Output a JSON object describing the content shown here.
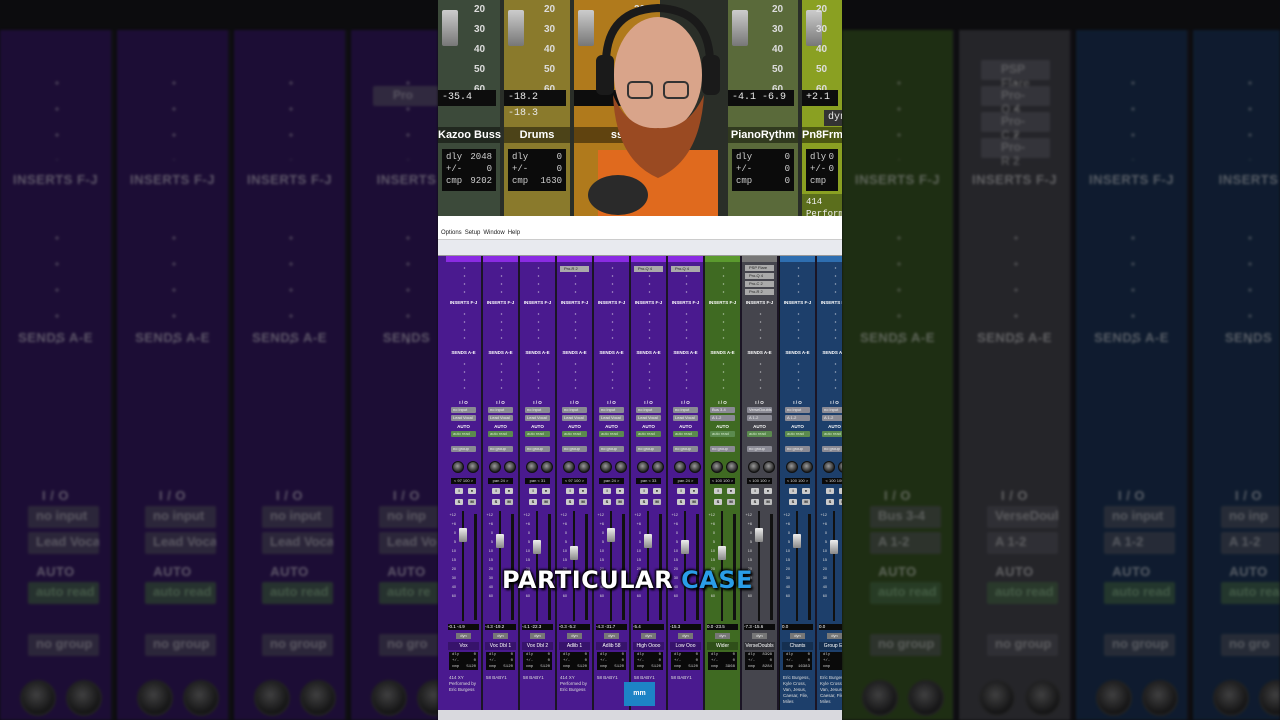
{
  "background": {
    "left_strips": [
      {
        "inserts": "INSERTS F-J",
        "sends": "SENDS A-E",
        "io": "I / O",
        "input": "no input",
        "output": "Lead Vocal",
        "auto": "AUTO",
        "auto_mode": "auto read",
        "group": "no group"
      },
      {
        "inserts": "INSERTS F-J",
        "sends": "SENDS A-E",
        "io": "I / O",
        "input": "no input",
        "output": "Lead Vocal",
        "auto": "AUTO",
        "auto_mode": "auto read",
        "group": "no group"
      },
      {
        "inserts": "INSERTS F-J",
        "sends": "SENDS A-E",
        "io": "I / O",
        "input": "no input",
        "output": "Lead Vocal",
        "auto": "AUTO",
        "auto_mode": "auto read",
        "group": "no group"
      },
      {
        "inserts": "INSERTS",
        "sends": "SENDS",
        "io": "I / O",
        "input": "no inp",
        "output": "Lead Vo",
        "auto": "AUTO",
        "auto_mode": "auto re",
        "group": "no gro",
        "insert_slot": "Pro"
      }
    ],
    "right_strips": [
      {
        "inserts": "INSERTS F-J",
        "sends": "SENDS A-E",
        "io": "I / O",
        "input": "Bus 3-4",
        "output": "A 1-2",
        "auto": "AUTO",
        "auto_mode": "auto read",
        "group": "no group"
      },
      {
        "inserts": "INSERTS F-J",
        "sends": "SENDS A-E",
        "io": "I / O",
        "input": "VerseDoubls",
        "output": "A 1-2",
        "auto": "AUTO",
        "auto_mode": "auto read",
        "group": "no group",
        "plugins": [
          "PSP Flare",
          "Pro-Q 4",
          "Pro-C 2",
          "Pro-R 2"
        ]
      },
      {
        "inserts": "INSERTS F-J",
        "sends": "SENDS A-E",
        "io": "I / O",
        "input": "no input",
        "output": "A 1-2",
        "auto": "AUTO",
        "auto_mode": "auto read",
        "group": "no group"
      },
      {
        "inserts": "INSERTS",
        "sends": "SENDS",
        "io": "I / O",
        "input": "no inp",
        "output": "A 1-2",
        "auto": "AUTO",
        "auto_mode": "auto rea",
        "group": "no gro"
      }
    ]
  },
  "webcam": {
    "strips": [
      {
        "name": "Kazoo Buss",
        "meter": "-35.4",
        "dly": "2048",
        "pm": "0",
        "cmp": "9202",
        "color": "#3c4a3a"
      },
      {
        "name": "Drums",
        "meter": "-18.2  -18.3",
        "dly": "0",
        "pm": "0",
        "cmp": "1630",
        "color": "#8a7a2c"
      },
      {
        "name": "ss",
        "meter": "",
        "dly": "",
        "pm": "",
        "cmp": "",
        "color": "#b07a1c"
      },
      {
        "name": "PianoRythm",
        "meter": "-4.1  -6.9",
        "dly": "0",
        "pm": "0",
        "cmp": "0",
        "color": "#5a6a3a"
      },
      {
        "name": "Pn8Frm",
        "meter": "+2.1",
        "dly": "0",
        "pm": "0",
        "cmp": "",
        "color": "#8aa022"
      }
    ],
    "scale": [
      "20",
      "30",
      "40",
      "50",
      "60"
    ],
    "labels": {
      "dly": "dly",
      "pm": "+/-",
      "cmp": "cmp"
    },
    "perf_label": "414",
    "perf_text": "Perform",
    "dyn_label": "dyn"
  },
  "menu": [
    "Options",
    "Setup",
    "Window",
    "Help"
  ],
  "mixer": {
    "inserts_label": "INSERTS F-J",
    "sends_label": "SENDS A-E",
    "io_label": "I / O",
    "auto_label": "AUTO",
    "auto_mode": "auto read",
    "group_label": "no group",
    "dyn_label": "dyn",
    "scale": [
      "+12",
      "+6",
      "0",
      "5",
      "10",
      "15",
      "20",
      "30",
      "40",
      "60"
    ],
    "info_labels": [
      "dly",
      "+/-",
      "cmp"
    ],
    "tracks": [
      {
        "name": "Vox",
        "input": "no input",
        "output": "Lead Vocal",
        "pan": "< 97  100 >",
        "vals": "-0.1  -4.9",
        "dly": "0",
        "pm": "0",
        "cmp": "5120",
        "comment": "414 XY Performed by Eric Burgess",
        "color": "purple"
      },
      {
        "name": "Voc Dbl 1",
        "input": "no input",
        "output": "Lead Vocal",
        "pan": "pan  24 >",
        "vals": "-4.3  -19.2",
        "dly": "0",
        "pm": "0",
        "cmp": "5120",
        "comment": "58 BABY1",
        "color": "purple"
      },
      {
        "name": "Vox Dbl 2",
        "input": "no input",
        "output": "Lead Vocal",
        "pan": "pan  < 31",
        "vals": "-4.1  -22.3",
        "dly": "0",
        "pm": "0",
        "cmp": "5120",
        "comment": "58 BABY1",
        "color": "purple"
      },
      {
        "name": "Adlib 1",
        "input": "no input",
        "output": "Lead Vocal",
        "pan": "< 97  100 >",
        "vals": "-0.3  -5.2",
        "dly": "0",
        "pm": "0",
        "cmp": "5120",
        "comment": "414 XY Performed by Eric Burgess",
        "color": "purple",
        "plugin": "Pro-R 2"
      },
      {
        "name": "Adlib 58",
        "input": "no input",
        "output": "Lead Vocal",
        "pan": "pan  24 >",
        "vals": "-4.3  -31.7",
        "dly": "0",
        "pm": "0",
        "cmp": "5120",
        "comment": "58 BABY1",
        "color": "purple"
      },
      {
        "name": "High Oooo",
        "input": "no input",
        "output": "Lead Vocal",
        "pan": "pan  < 33",
        "vals": "-5.4",
        "dly": "0",
        "pm": "0",
        "cmp": "5120",
        "comment": "58 BABY1",
        "color": "purple",
        "plugin": "Pro-Q 4"
      },
      {
        "name": "Low Ooo",
        "input": "no input",
        "output": "Lead Vocal",
        "pan": "pan  24 >",
        "vals": "-15.3",
        "dly": "0",
        "pm": "0",
        "cmp": "5120",
        "comment": "58 BABY1",
        "color": "purple",
        "plugin": "Pro-Q 4"
      },
      {
        "name": "Wider",
        "input": "Bus 3-4",
        "output": "A 1-2",
        "pan": "< 100  100 >",
        "vals": "0.0  -23.5",
        "dly": "0",
        "pm": "0",
        "cmp": "3968",
        "comment": "",
        "color": "green"
      },
      {
        "name": "VerseDoubls",
        "input": "VerseDoubls",
        "output": "A 1-2",
        "pan": "< 100  100 >",
        "vals": "-7.3  -15.6",
        "dly": "8398",
        "pm": "0",
        "cmp": "8284",
        "comment": "",
        "color": "gray",
        "plugins": [
          "PSP Flare",
          "Pro-Q 4",
          "Pro-C 2",
          "Pro-R 2"
        ]
      },
      {
        "name": "Chants",
        "input": "no input",
        "output": "A 1-2",
        "pan": "< 100  100 >",
        "vals": "0.0",
        "dly": "0",
        "pm": "0",
        "cmp": "16383",
        "comment": "Eric Burgess, Kyle Cross, Van, Jesus, Caesar, File, Miles",
        "color": "blue"
      },
      {
        "name": "Group Ee",
        "input": "no input",
        "output": "A 1-2",
        "pan": "< 100  100",
        "vals": "0.0",
        "dly": "0",
        "pm": "0",
        "cmp": "0",
        "comment": "Eric Burgess, Kyle Cross, Van, Jesus, Caesar, File, Miles",
        "color": "blue"
      }
    ]
  },
  "caption": {
    "word1": "PARTICULAR",
    "word2": "CASE"
  },
  "logo": {
    "text": "mm"
  }
}
